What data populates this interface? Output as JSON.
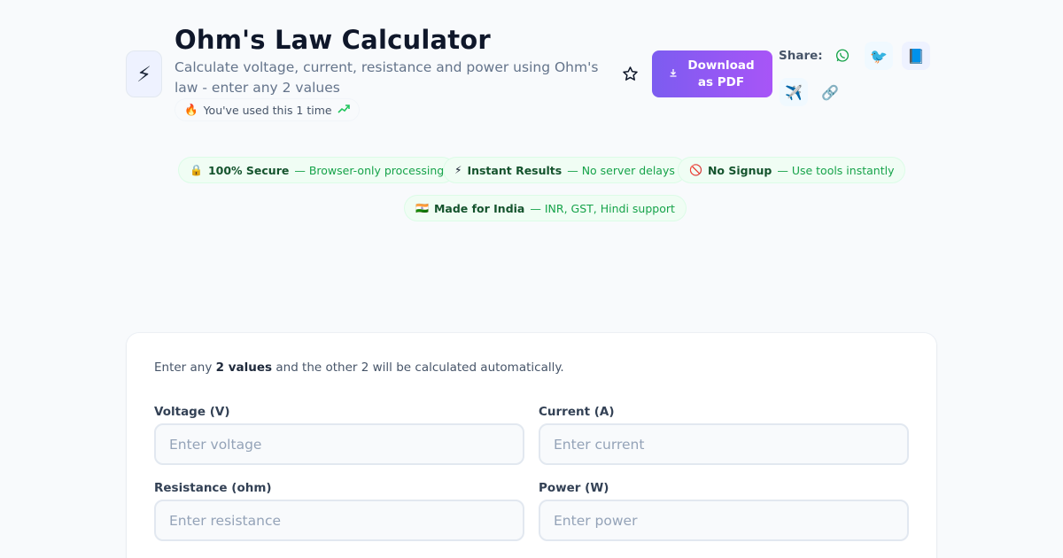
{
  "header": {
    "tool_icon": "lightning-bolt-icon",
    "tool_icon_glyph": "⚡",
    "title": "Ohm's Law Calculator",
    "subtitle": "Calculate voltage, current, resistance and power using Ohm's law - enter any 2 values",
    "usage": {
      "emoji": "🔥",
      "text": "You've used this 1 time",
      "trend_icon": "trending-up-icon"
    },
    "favorite_icon": "star-icon",
    "download_label": "Download as PDF",
    "download_icon": "download-icon",
    "share_label": "Share:",
    "share_buttons": [
      {
        "name": "whatsapp",
        "icon": "whatsapp-icon",
        "glyph": "✆"
      },
      {
        "name": "twitter",
        "icon": "bird-icon",
        "glyph": "🐦"
      },
      {
        "name": "facebook",
        "icon": "book-icon",
        "glyph": "📘"
      },
      {
        "name": "telegram",
        "icon": "airplane-icon",
        "glyph": "✈️"
      },
      {
        "name": "copy-link",
        "icon": "link-icon",
        "glyph": "🔗"
      }
    ]
  },
  "badges": [
    {
      "icon": "🔒",
      "title": "100% Secure",
      "desc": "— Browser-only processing"
    },
    {
      "icon": "⚡",
      "title": "Instant Results",
      "desc": "— No server delays"
    },
    {
      "icon": "🚫",
      "title": "No Signup",
      "desc": "— Use tools instantly"
    },
    {
      "icon": "🇮🇳",
      "title": "Made for India",
      "desc": "— INR, GST, Hindi support"
    }
  ],
  "calculator": {
    "intro_before": "Enter any ",
    "intro_bold": "2 values",
    "intro_after": " and the other 2 will be calculated automatically.",
    "fields": {
      "voltage": {
        "label": "Voltage (V)",
        "placeholder": "Enter voltage",
        "value": ""
      },
      "current": {
        "label": "Current (A)",
        "placeholder": "Enter current",
        "value": ""
      },
      "resistance": {
        "label": "Resistance (ohm)",
        "placeholder": "Enter resistance",
        "value": ""
      },
      "power": {
        "label": "Power (W)",
        "placeholder": "Enter power",
        "value": ""
      }
    }
  },
  "colors": {
    "accent_gradient_start": "#7c5cf0",
    "accent_gradient_end": "#a855f7",
    "badge_text": "#14532d",
    "badge_desc": "#16a34a",
    "page_bg": "#f8fafc"
  }
}
